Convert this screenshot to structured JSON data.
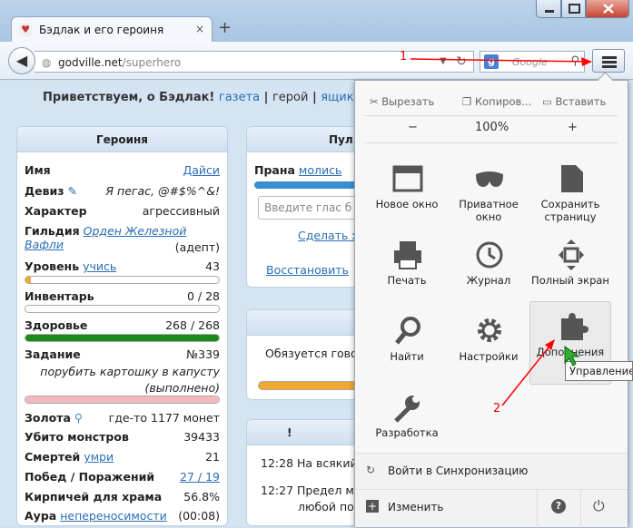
{
  "browser": {
    "tab_title": "Бэдлак и его героиня",
    "tab_close": "×",
    "new_tab": "+",
    "url_domain": "godville.net",
    "url_path": "/superhero",
    "search_engine": "g",
    "search_placeholder": "Google"
  },
  "page": {
    "greeting": "Приветствуем, о Бэдлак!",
    "top_links": [
      "газета",
      "герой",
      "ящик"
    ]
  },
  "hero_panel": {
    "title": "Героиня",
    "name_label": "Имя",
    "name_value": "Дайси",
    "motto_label": "Девиз",
    "motto_value": "Я пегас, @#$%^&!",
    "character_label": "Характер",
    "character_value": "агрессивный",
    "guild_label": "Гильдия",
    "guild_value": "Орден Железной Вафли",
    "guild_rank": "(адепт)",
    "level_label": "Уровень",
    "level_link": "учись",
    "level_value": "43",
    "level_progress": 0.03,
    "inventory_label": "Инвентарь",
    "inventory_value": "0 / 28",
    "inventory_progress": 0,
    "health_label": "Здоровье",
    "health_value": "268 / 268",
    "health_progress": 1.0,
    "quest_label": "Задание",
    "quest_number": "№339",
    "quest_text": "порубить картошку в капусту",
    "quest_status": "(выполнено)",
    "quest_progress": 1.0,
    "gold_label": "Золота",
    "gold_value": "где-то 1177 монет",
    "kills_label": "Убито монстров",
    "kills_value": "39433",
    "deaths_label": "Смертей",
    "deaths_link": "умри",
    "deaths_value": "21",
    "wins_label": "Побед / Поражений",
    "wins_value": "27 / 19",
    "bricks_label": "Кирпичей для храма",
    "bricks_value": "56.8%",
    "aura_label": "Аура",
    "aura_value": "непереносимости",
    "aura_time": "(00:08)"
  },
  "mid_panels": {
    "pult_title": "Пул",
    "prana_label": "Прана",
    "prana_link": "молись",
    "voice_placeholder": "Введите глас б",
    "make_link": "Сделать х",
    "restore_link": "Восстановить",
    "promise_text": "Обязуется гово",
    "diary_title": "!",
    "diary": [
      {
        "time": "12:28",
        "text": "На всякий"
      },
      {
        "time": "12:27",
        "text": "Предел мн"
      },
      {
        "time": "",
        "text": "любой по"
      }
    ]
  },
  "firefox_menu": {
    "cut": "Вырезать",
    "copy": "Копиров...",
    "paste": "Вставить",
    "zoom_out": "−",
    "zoom_level": "100%",
    "zoom_in": "+",
    "items": [
      {
        "label": "Новое окно",
        "icon": "window-icon"
      },
      {
        "label": "Приватное окно",
        "icon": "mask-icon"
      },
      {
        "label": "Сохранить страницу",
        "icon": "page-icon"
      },
      {
        "label": "Печать",
        "icon": "printer-icon"
      },
      {
        "label": "Журнал",
        "icon": "clock-icon"
      },
      {
        "label": "Полный экран",
        "icon": "fullscreen-icon"
      },
      {
        "label": "Найти",
        "icon": "magnifier-icon"
      },
      {
        "label": "Настройки",
        "icon": "gear-icon"
      },
      {
        "label": "Дополнения",
        "icon": "puzzle-icon"
      },
      {
        "label": "Разработка",
        "icon": "wrench-icon"
      }
    ],
    "sync": "Войти в Синхронизацию",
    "customize": "Изменить"
  },
  "tooltip": "Управление",
  "annotations": [
    "1",
    "2"
  ],
  "colors": {
    "annotation": "#ff0000",
    "health": "#1a8a1a",
    "quest": "#f2b8bd",
    "level": "#f0a830"
  }
}
